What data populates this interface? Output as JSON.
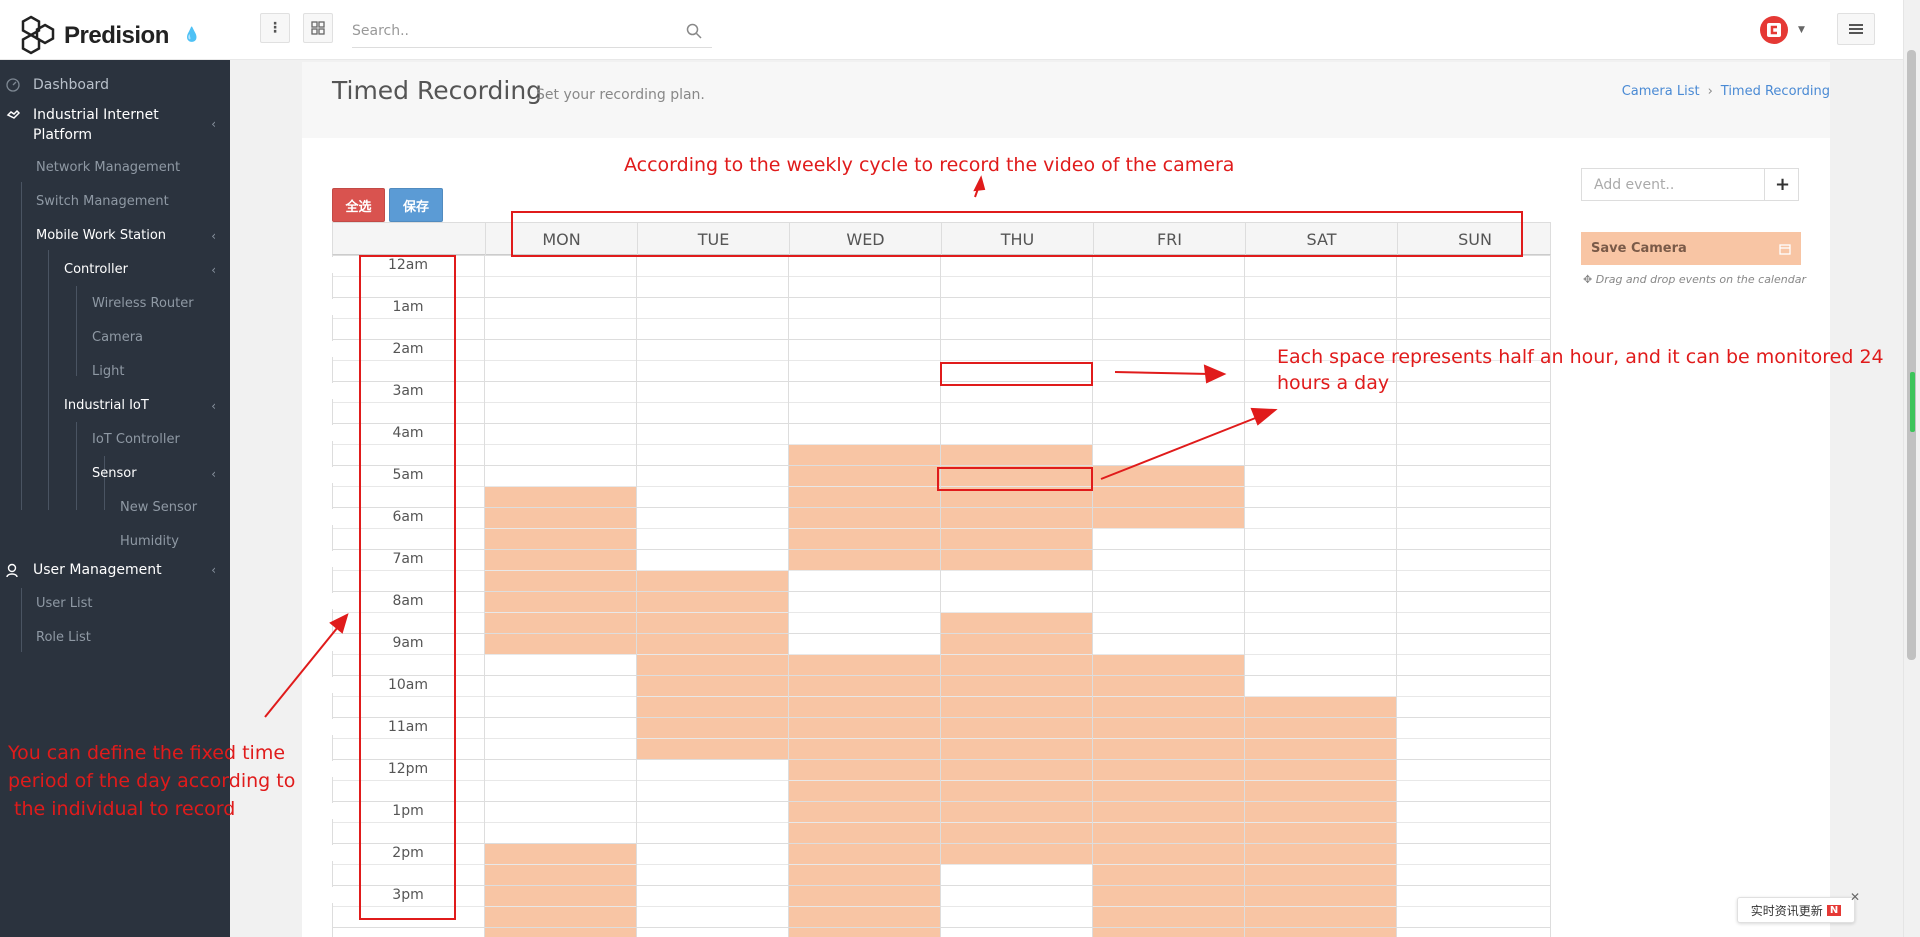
{
  "brand": {
    "name": "Predision"
  },
  "search": {
    "placeholder": "Search.."
  },
  "sidebar": {
    "dashboard": "Dashboard",
    "iip": "Industrial Internet",
    "iip2": "Platform",
    "network": "Network Management",
    "switch": "Switch Management",
    "mobile": "Mobile Work Station",
    "controller": "Controller",
    "router": "Wireless Router",
    "camera": "Camera",
    "light": "Light",
    "iot": "Industrial IoT",
    "iotctrl": "IoT Controller",
    "sensor": "Sensor",
    "newsensor": "New Sensor",
    "humidity": "Humidity",
    "usermgmt": "User Management",
    "userlist": "User List",
    "rolelist": "Role List"
  },
  "header": {
    "title": "Timed Recording",
    "subtitle": "Set your recording plan.",
    "crumb1": "Camera List",
    "crumb_sep": "›",
    "crumb2": "Timed Recording"
  },
  "buttons": {
    "select_all": "全选",
    "save": "保存"
  },
  "calendar": {
    "days": [
      "MON",
      "TUE",
      "WED",
      "THU",
      "FRI",
      "SAT",
      "SUN"
    ],
    "times": [
      "12am",
      "1am",
      "2am",
      "3am",
      "4am",
      "5am",
      "6am",
      "7am",
      "8am",
      "9am",
      "10am",
      "11am",
      "12pm",
      "1pm",
      "2pm",
      "3pm"
    ],
    "fill_color": "#f8c5a4"
  },
  "side": {
    "add_placeholder": "Add event..",
    "plus": "+",
    "save_camera": "Save Camera",
    "hint": "Drag and drop events on the calendar"
  },
  "annotations": {
    "top": "According to the weekly cycle to record the video of the camera",
    "right": "Each space represents half an hour, and it can be monitored 24 hours a day",
    "left1": "You can define the fixed time",
    "left2": "period of the day according to",
    "left3": " the individual to record"
  },
  "toast": "实时资讯更新"
}
